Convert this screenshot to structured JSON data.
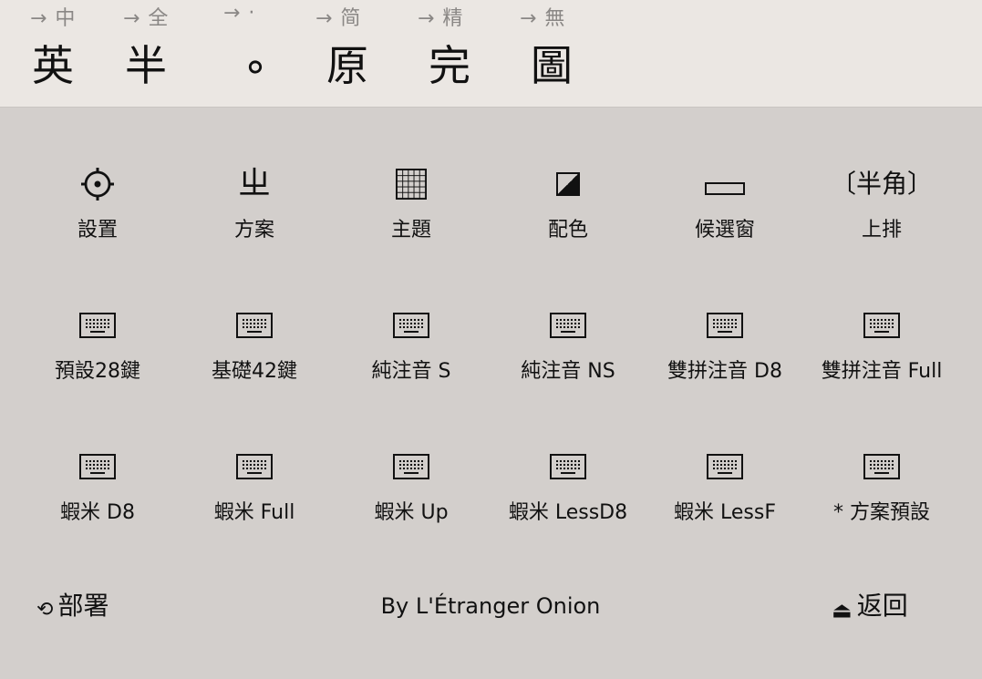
{
  "toggles": [
    {
      "hint": "→ 中",
      "main": "英"
    },
    {
      "hint": "→ 全",
      "main": "半"
    },
    {
      "hint": "→ ·",
      "main": "∘"
    },
    {
      "hint": "→ 简",
      "main": "原"
    },
    {
      "hint": "→ 精",
      "main": "完"
    },
    {
      "hint": "→ 無",
      "main": "圖"
    }
  ],
  "settings": [
    {
      "label": "設置",
      "icon": "gear-icon"
    },
    {
      "label": "方案",
      "icon": "bopomofo-zh-icon",
      "glyph": "ㄓ"
    },
    {
      "label": "主題",
      "icon": "grid-icon"
    },
    {
      "label": "配色",
      "icon": "half-filled-square-icon"
    },
    {
      "label": "候選窗",
      "icon": "rectangle-icon"
    },
    {
      "label": "上排",
      "icon": "half-width-icon",
      "glyph": "〔半角〕"
    }
  ],
  "layouts_row1": [
    {
      "label": "預設28鍵"
    },
    {
      "label": "基礎42鍵"
    },
    {
      "label": "純注音 S"
    },
    {
      "label": "純注音 NS"
    },
    {
      "label": "雙拼注音 D8"
    },
    {
      "label": "雙拼注音 Full"
    }
  ],
  "layouts_row2": [
    {
      "label": "蝦米 D8"
    },
    {
      "label": "蝦米 Full"
    },
    {
      "label": "蝦米 Up"
    },
    {
      "label": "蝦米 LessD8"
    },
    {
      "label": "蝦米 LessF"
    },
    {
      "label": "* 方案預設"
    }
  ],
  "footer": {
    "deploy_icon": "⟲",
    "deploy_label": "部署",
    "credit": "By L'Étranger Onion",
    "back_icon": "⏏",
    "back_label": "返回"
  }
}
